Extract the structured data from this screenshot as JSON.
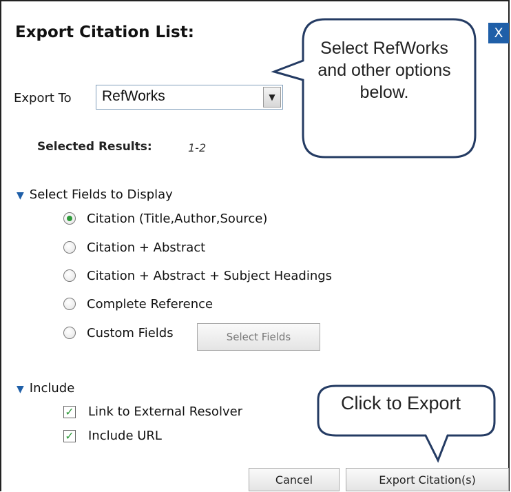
{
  "dialog": {
    "title": "Export Citation List:",
    "close_label": "X"
  },
  "export": {
    "label": "Export To",
    "selected": "RefWorks"
  },
  "selected_results": {
    "label": "Selected Results:",
    "value": "1-2"
  },
  "fields_section": {
    "heading": "Select Fields to Display",
    "options": [
      {
        "label": "Citation (Title,Author,Source)",
        "checked": true
      },
      {
        "label": "Citation + Abstract",
        "checked": false
      },
      {
        "label": "Citation + Abstract + Subject Headings",
        "checked": false
      },
      {
        "label": "Complete Reference",
        "checked": false
      },
      {
        "label": "Custom Fields",
        "checked": false
      }
    ],
    "select_fields_button": "Select Fields"
  },
  "include_section": {
    "heading": "Include",
    "options": [
      {
        "label": "Link to External Resolver",
        "checked": true
      },
      {
        "label": "Include URL",
        "checked": true
      }
    ]
  },
  "buttons": {
    "cancel": "Cancel",
    "export": "Export Citation(s)"
  },
  "callouts": {
    "top": "Select RefWorks and other options below.",
    "bottom": "Click to Export"
  },
  "colors": {
    "accent": "#1f5fa8",
    "check": "#2e9a3a",
    "callout_border": "#243b63"
  }
}
